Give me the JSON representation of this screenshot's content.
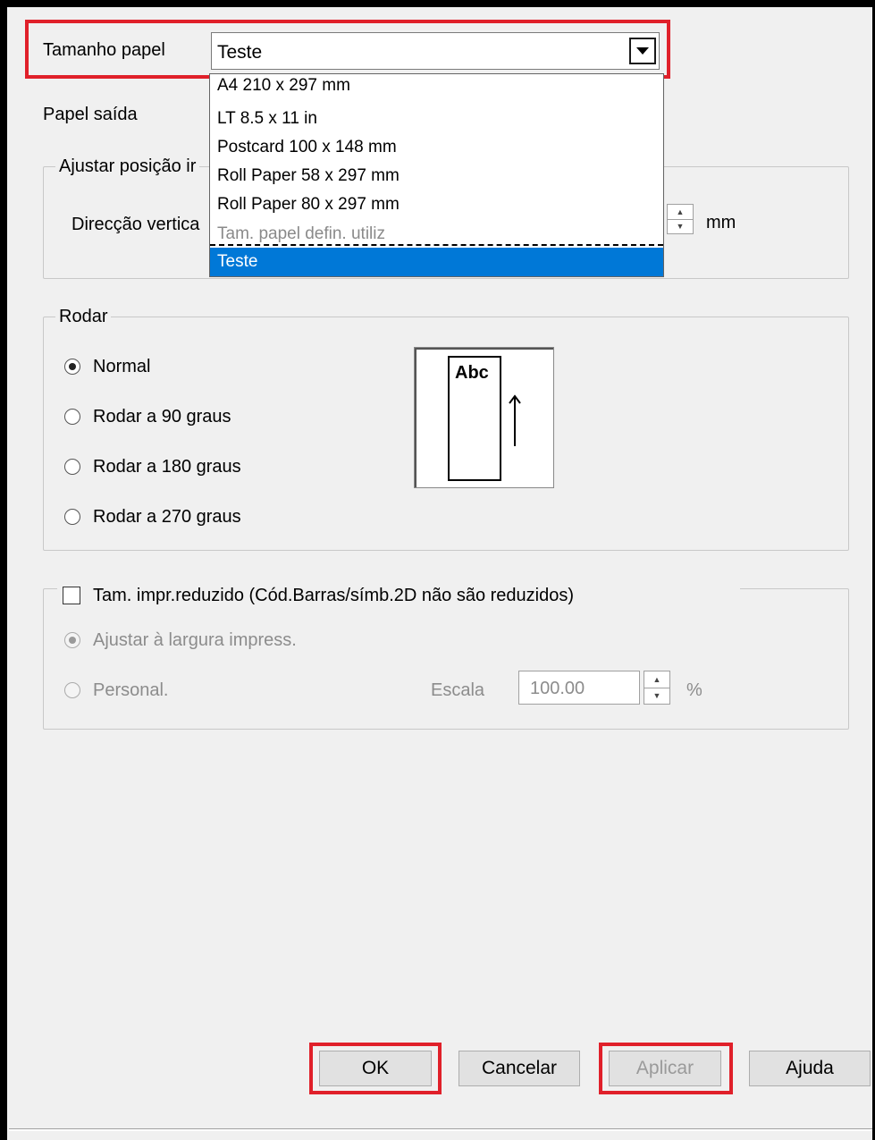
{
  "paper_size": {
    "label": "Tamanho papel",
    "value": "Teste",
    "options": [
      "A4 210 x 297 mm",
      "LT 8.5 x 11 in",
      "Postcard 100 x 148 mm",
      "Roll Paper 58 x 297 mm",
      "Roll Paper 80 x 297 mm",
      "Tam. papel defin. utiliz",
      "Teste"
    ]
  },
  "paper_output": {
    "label": "Papel saída"
  },
  "adjust_position": {
    "title": "Ajustar posição ir",
    "vertical_label": "Direcção vertica",
    "unit": "mm"
  },
  "rotate": {
    "title": "Rodar",
    "options": [
      "Normal",
      "Rodar a 90 graus",
      "Rodar a 180 graus",
      "Rodar a 270 graus"
    ],
    "selected": "Normal",
    "preview_text": "Abc"
  },
  "reduced": {
    "checkbox_label": "Tam. impr.reduzido (Cód.Barras/símb.2D não são reduzidos)",
    "checked": false,
    "fit_label": "Ajustar à largura impress.",
    "custom_label": "Personal.",
    "scale_label": "Escala",
    "scale_value": "100.00",
    "scale_unit": "%"
  },
  "buttons": {
    "ok": "OK",
    "cancel": "Cancelar",
    "apply": "Aplicar",
    "help": "Ajuda"
  },
  "colors": {
    "highlight": "#e0202a",
    "selection": "#0078d7"
  }
}
